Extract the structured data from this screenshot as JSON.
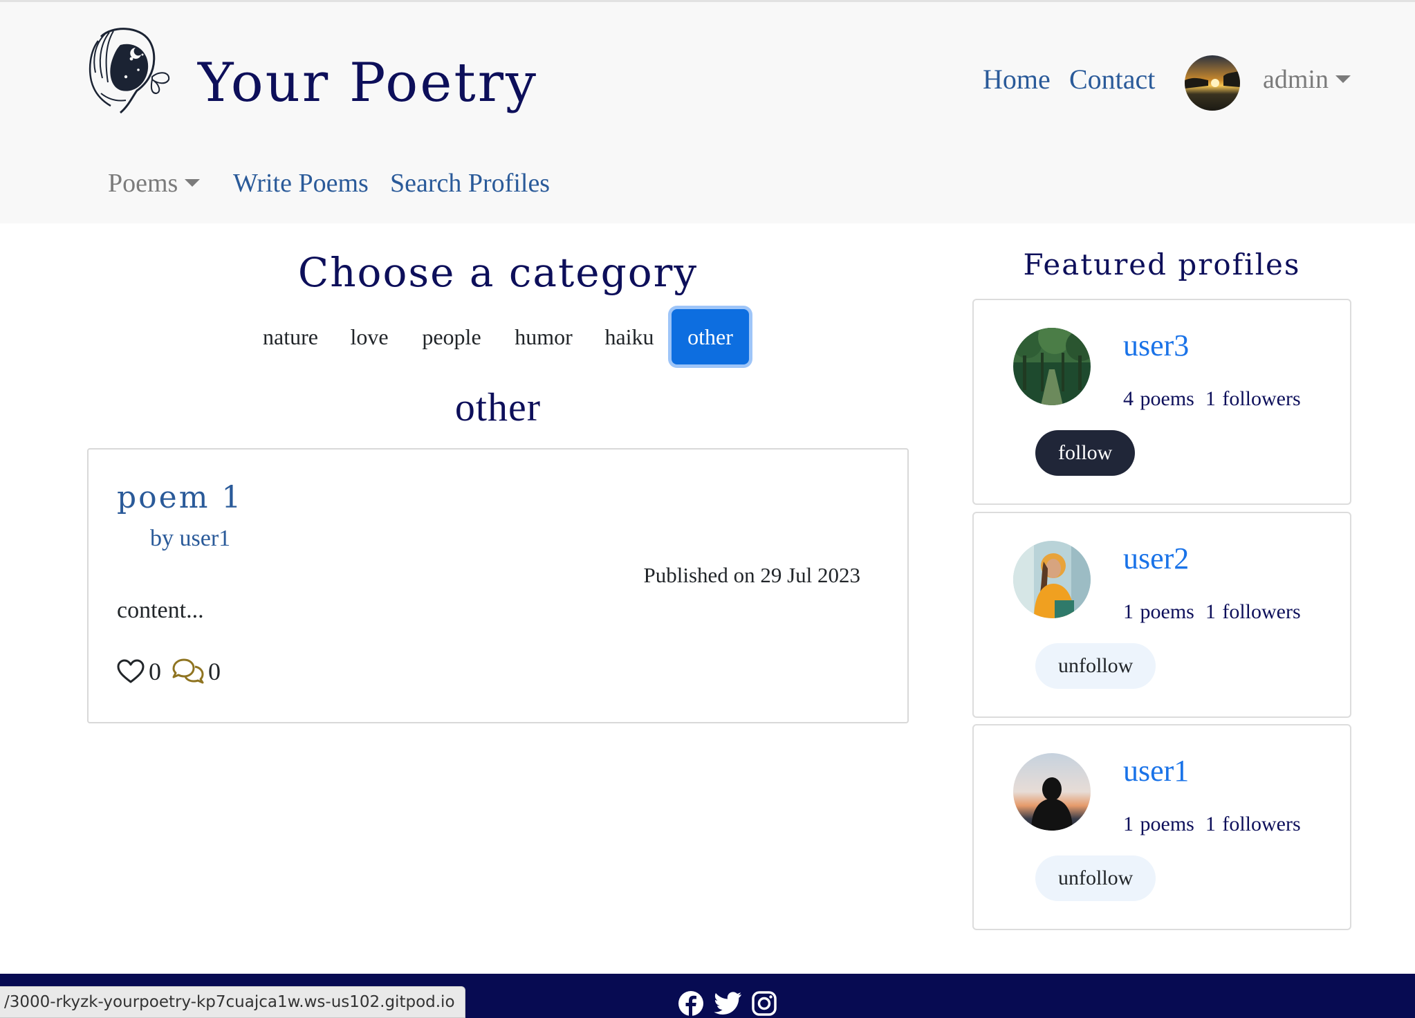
{
  "header": {
    "brand": "Your Poetry",
    "nav": {
      "home": "Home",
      "contact": "Contact",
      "user": "admin"
    },
    "subnav": {
      "poems": "Poems",
      "write": "Write Poems",
      "search": "Search Profiles"
    }
  },
  "categories": {
    "title": "Choose a category",
    "items": [
      "nature",
      "love",
      "people",
      "humor",
      "haiku",
      "other"
    ],
    "active": "other"
  },
  "poems": [
    {
      "title": "poem 1",
      "author": "by user1",
      "published": "Published on 29 Jul 2023",
      "content": "content...",
      "likes": "0",
      "comments": "0"
    }
  ],
  "featured": {
    "title": "Featured profiles",
    "profiles": [
      {
        "name": "user3",
        "poems": "4 poems",
        "followers": "1 followers",
        "button": "follow"
      },
      {
        "name": "user2",
        "poems": "1 poems",
        "followers": "1 followers",
        "button": "unfollow"
      },
      {
        "name": "user1",
        "poems": "1 poems",
        "followers": "1 followers",
        "button": "unfollow"
      }
    ]
  },
  "footer": {
    "social_icons": [
      "facebook-icon",
      "twitter-icon",
      "instagram-icon"
    ]
  },
  "statusbar": {
    "url": "/3000-rkyzk-yourpoetry-kp7cuajca1w.ws-us102.gitpod.io"
  },
  "colors": {
    "navy": "#0d0f5a",
    "link": "#2a5a99",
    "accent": "#0d6ee0",
    "footer": "#070b52"
  }
}
